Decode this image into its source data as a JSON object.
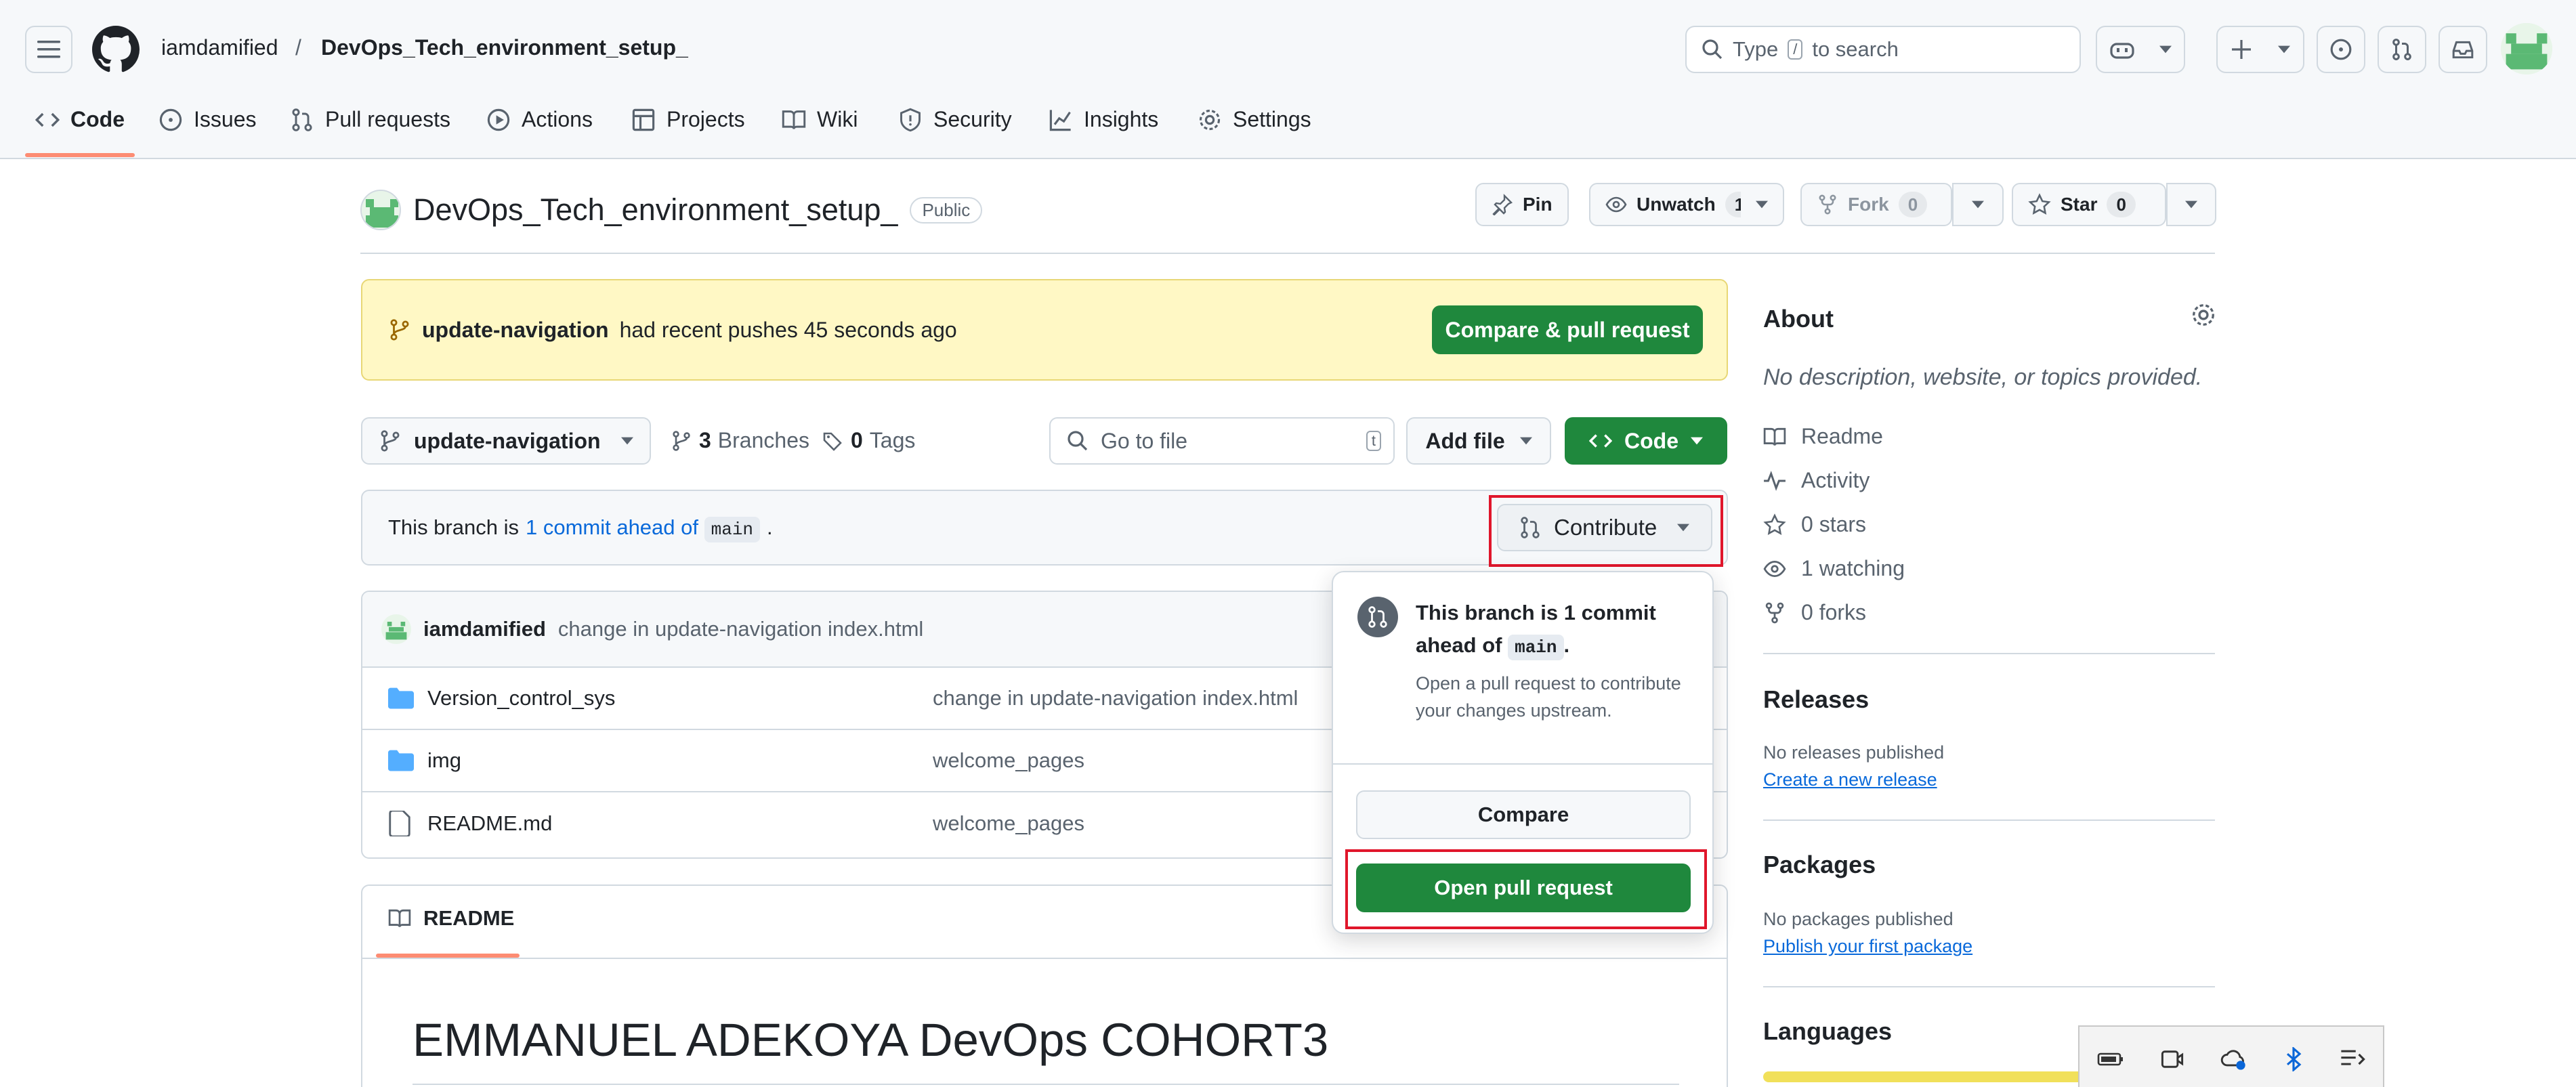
{
  "header": {
    "owner": "iamdamified",
    "separator": "/",
    "repo": "DevOps_Tech_environment_setup_",
    "search": {
      "prefix": "Type",
      "key": "/",
      "suffix": "to search"
    }
  },
  "nav": {
    "tabs": [
      {
        "label": "Code",
        "icon": "code-icon",
        "active": true
      },
      {
        "label": "Issues",
        "icon": "issue-icon"
      },
      {
        "label": "Pull requests",
        "icon": "pull-request-icon"
      },
      {
        "label": "Actions",
        "icon": "play-icon"
      },
      {
        "label": "Projects",
        "icon": "table-icon"
      },
      {
        "label": "Wiki",
        "icon": "book-icon"
      },
      {
        "label": "Security",
        "icon": "shield-icon"
      },
      {
        "label": "Insights",
        "icon": "graph-icon"
      },
      {
        "label": "Settings",
        "icon": "gear-icon"
      }
    ]
  },
  "repo": {
    "name": "DevOps_Tech_environment_setup_",
    "visibility": "Public",
    "pin_label": "Pin",
    "unwatch_label": "Unwatch",
    "watch_count": "1",
    "fork_label": "Fork",
    "fork_count": "0",
    "star_label": "Star",
    "star_count": "0"
  },
  "banner": {
    "branch": "update-navigation",
    "text": "had recent pushes 45 seconds ago",
    "button": "Compare & pull request"
  },
  "toolbar": {
    "branch": "update-navigation",
    "branches_count": "3",
    "branches_label": "Branches",
    "tags_count": "0",
    "tags_label": "Tags",
    "goto_placeholder": "Go to file",
    "goto_key": "t",
    "add_file": "Add file",
    "code": "Code"
  },
  "ahead": {
    "prefix": "This branch is",
    "link": "1 commit ahead of",
    "branch": "main",
    "suffix": ".",
    "contribute": "Contribute"
  },
  "commit": {
    "author": "iamdamified",
    "message": "change in update-navigation index.html"
  },
  "files": [
    {
      "name": "Version_control_sys",
      "type": "folder",
      "message": "change in update-navigation index.html"
    },
    {
      "name": "img",
      "type": "folder",
      "message": "welcome_pages"
    },
    {
      "name": "README.md",
      "type": "file",
      "message": "welcome_pages"
    }
  ],
  "readme": {
    "tab": "README",
    "heading": "EMMANUEL ADEKOYA DevOps COHORT3"
  },
  "popover": {
    "title_prefix": "This branch is 1 commit ahead of",
    "title_branch": "main",
    "title_suffix": ".",
    "description": "Open a pull request to contribute your changes upstream.",
    "compare": "Compare",
    "open_pr": "Open pull request"
  },
  "sidebar": {
    "about_title": "About",
    "about_desc": "No description, website, or topics provided.",
    "links": [
      {
        "label": "Readme",
        "icon": "book-icon"
      },
      {
        "label": "Activity",
        "icon": "pulse-icon"
      },
      {
        "label": "0 stars",
        "icon": "star-icon"
      },
      {
        "label": "1 watching",
        "icon": "eye-icon"
      },
      {
        "label": "0 forks",
        "icon": "fork-icon"
      }
    ],
    "releases_title": "Releases",
    "releases_text": "No releases published",
    "releases_link": "Create a new release",
    "packages_title": "Packages",
    "packages_text": "No packages published",
    "packages_link": "Publish your first package",
    "languages_title": "Languages"
  },
  "colors": {
    "green": "#1f883d",
    "link": "#0969da",
    "highlight_red": "#e0162b",
    "banner": "#fff8c5",
    "nav_underline": "#fd8c73"
  }
}
